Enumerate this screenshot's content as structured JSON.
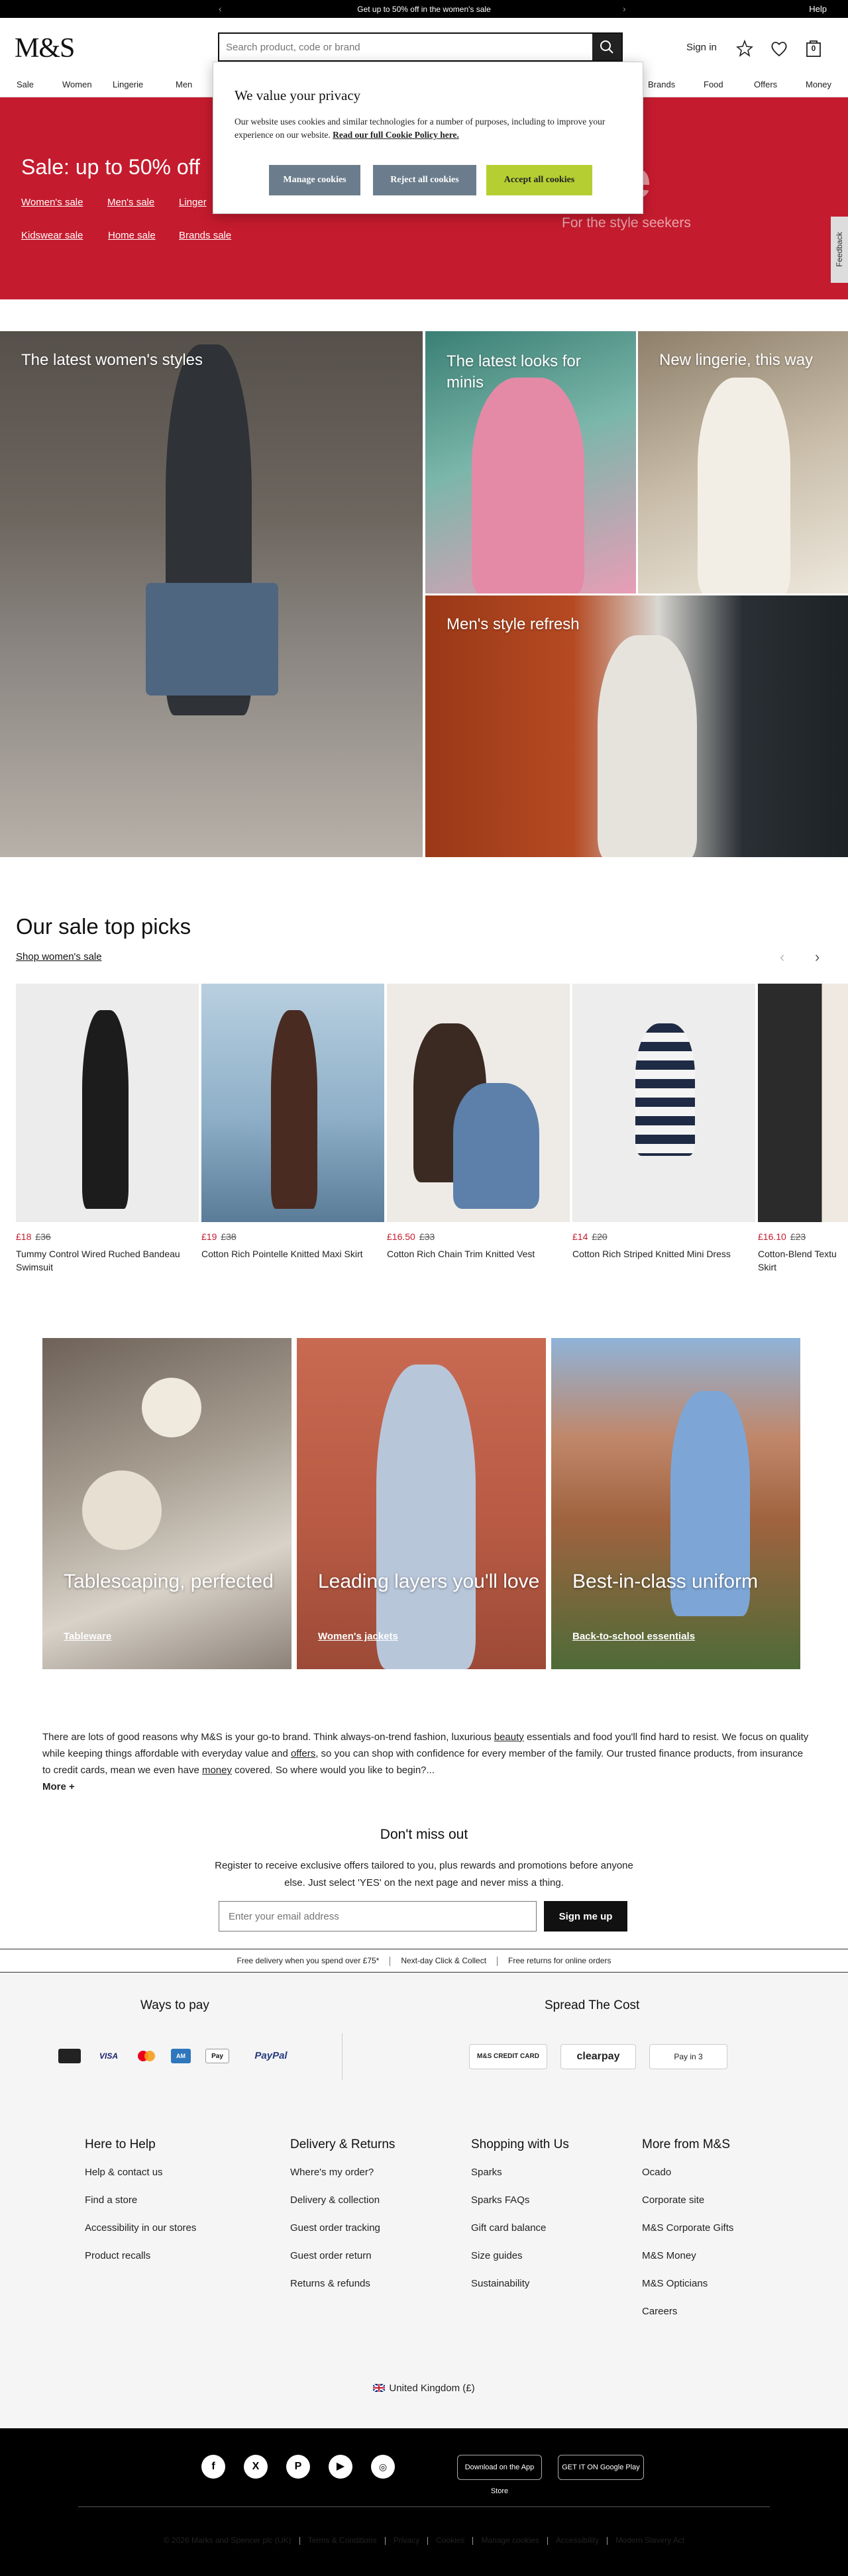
{
  "promo": {
    "text": "Get up to 50% off in the women's sale",
    "help": "Help"
  },
  "header": {
    "logo": "M&S",
    "search_placeholder": "Search product, code or brand",
    "sign_in": "Sign in",
    "bag_count": "0",
    "nav_left": [
      "Sale",
      "Women",
      "Lingerie",
      "Men"
    ],
    "nav_right": [
      "Brands",
      "Food",
      "Offers",
      "Money"
    ]
  },
  "sale_hero": {
    "title": "Sale: up to 50% off",
    "links": [
      "Women's sale",
      "Men's sale",
      "Linger",
      "Kidswear sale",
      "Home sale",
      "Brands sale"
    ],
    "big_text": "le",
    "subtitle": "For the style seekers",
    "feedback": "Feedback"
  },
  "cookie": {
    "title": "We value your privacy",
    "text": "Our website uses cookies and similar technologies for a number of purposes, including to improve your experience on our website.",
    "policy_link": "Read our full Cookie Policy here.",
    "manage": "Manage cookies",
    "reject": "Reject all cookies",
    "accept": "Accept all cookies"
  },
  "tiles": {
    "womens": "The latest women's styles",
    "minis": "The latest looks for minis",
    "lingerie": "New lingerie, this way",
    "mens": "Men's style refresh"
  },
  "picks": {
    "title": "Our sale top picks",
    "link": "Shop women's sale",
    "products": [
      {
        "now": "£18",
        "was": "£36",
        "name": "Tummy Control Wired Ruched Bandeau Swimsuit"
      },
      {
        "now": "£19",
        "was": "£38",
        "name": "Cotton Rich Pointelle Knitted Maxi Skirt"
      },
      {
        "now": "£16.50",
        "was": "£33",
        "name": "Cotton Rich Chain Trim Knitted Vest"
      },
      {
        "now": "£14",
        "was": "£20",
        "name": "Cotton Rich Striped Knitted Mini Dress"
      },
      {
        "now": "£16.10",
        "was": "£23",
        "name": "Cotton-Blend Textu Skirt"
      }
    ]
  },
  "panels": [
    {
      "title": "Tablescaping, perfected",
      "link": "Tableware"
    },
    {
      "title": "Leading layers you'll love",
      "link": "Women's jackets"
    },
    {
      "title": "Best-in-class uniform",
      "link": "Back-to-school essentials"
    }
  ],
  "about": {
    "p1": "There are lots of good reasons why M&S is your go-to brand. Think always-on-trend fashion, luxurious ",
    "beauty": "beauty",
    "p2": " essentials and food you'll find hard to resist. We focus on quality while keeping things affordable with everyday value and ",
    "offers": "offers",
    "p3": ", so you can shop with confidence for every member of the family. Our trusted finance products, from insurance to credit cards, mean we even have ",
    "money": "money",
    "p4": " covered. So where would you like to begin?...",
    "more": "More +"
  },
  "newsletter": {
    "title": "Don't miss out",
    "text": "Register to receive exclusive offers tailored to you, plus rewards and promotions before anyone else. Just select 'YES' on the next page and never miss a thing.",
    "placeholder": "Enter your email address",
    "button": "Sign me up"
  },
  "benefits": [
    "Free delivery when you spend over £75*",
    "Next-day Click & Collect",
    "Free returns for online orders"
  ],
  "payment": {
    "ways_title": "Ways to pay",
    "spread_title": "Spread The Cost",
    "methods": [
      "Card",
      "VISA",
      "Mastercard",
      "Amex",
      "Apple Pay",
      "PayPal"
    ],
    "spread": [
      "M&S CREDIT CARD",
      "clearpay",
      "Pay in 3"
    ]
  },
  "footer_cols": [
    {
      "title": "Here to Help",
      "items": [
        "Help & contact us",
        "Find a store",
        "Accessibility in our stores",
        "Product recalls"
      ]
    },
    {
      "title": "Delivery & Returns",
      "items": [
        "Where's my order?",
        "Delivery & collection",
        "Guest order tracking",
        "Guest order return",
        "Returns & refunds"
      ]
    },
    {
      "title": "Shopping with Us",
      "items": [
        "Sparks",
        "Sparks FAQs",
        "Gift card balance",
        "Size guides",
        "Sustainability"
      ]
    },
    {
      "title": "More from M&S",
      "items": [
        "Ocado",
        "Corporate site",
        "M&S Corporate Gifts",
        "M&S Money",
        "M&S Opticians",
        "Careers"
      ]
    }
  ],
  "locale": "United Kingdom (£)",
  "apps": {
    "appstore": "Download on the App Store",
    "googleplay": "GET IT ON Google Play"
  },
  "legal": [
    "© 2026 Marks and Spencer plc (UK)",
    "Terms & Conditions",
    "Privacy",
    "Cookies",
    "Manage cookies",
    "Accessibility",
    "Modern Slavery Act"
  ],
  "colors": {
    "sale_red": "#c51b2e",
    "accept_green": "#b5cf33",
    "manage_grey": "#6b7d8c"
  }
}
